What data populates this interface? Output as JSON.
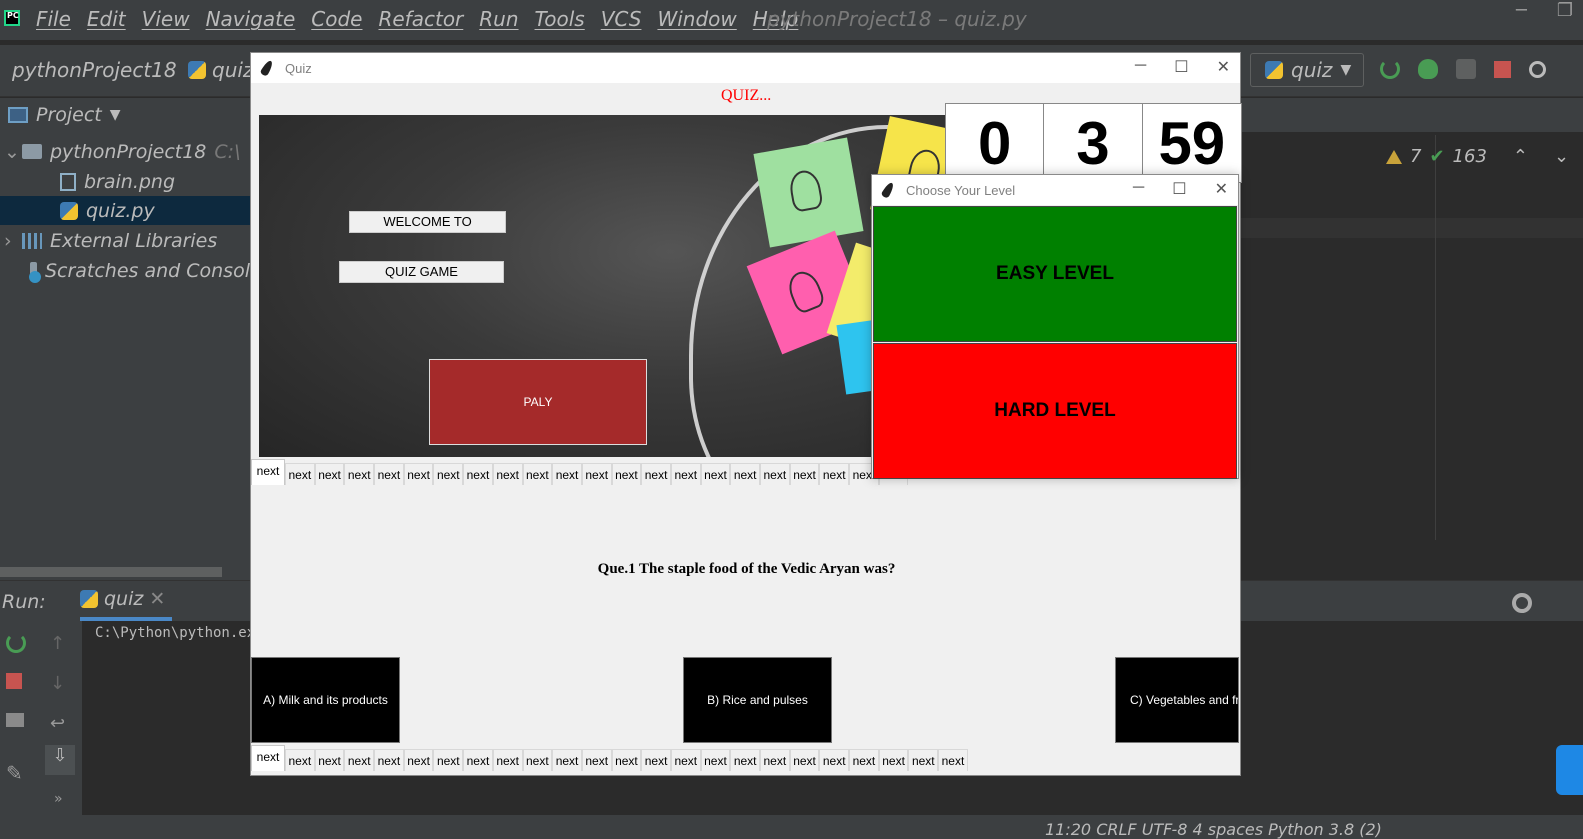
{
  "ide": {
    "menu": [
      "File",
      "Edit",
      "View",
      "Navigate",
      "Code",
      "Refactor",
      "Run",
      "Tools",
      "VCS",
      "Window",
      "Help"
    ],
    "window_title": "pythonProject18 – quiz.py",
    "breadcrumb_project": "pythonProject18",
    "breadcrumb_file": "quiz",
    "run_config": "quiz",
    "project_pane_title": "Project",
    "tree": {
      "root": "pythonProject18",
      "root_path": "C:\\",
      "files": [
        "brain.png",
        "quiz.py"
      ],
      "external": "External Libraries",
      "scratches": "Scratches and Consol"
    },
    "inspections": {
      "warnings": "7",
      "ok": "163"
    },
    "run_label": "Run:",
    "run_tab": "quiz",
    "console_line": "C:\\Python\\python.exe",
    "status": "11:20   CRLF   UTF-8   4 spaces   Python 3.8 (2)"
  },
  "quiz_window": {
    "title": "Quiz",
    "heading": "QUIZ...",
    "welcome": "WELCOME TO",
    "quiz_game": "QUIZ GAME",
    "play": "PALY",
    "timer": {
      "h": "0",
      "m": "3",
      "s": "59"
    },
    "tab_label": "next",
    "question": "Que.1 The staple food of the Vedic Aryan was?",
    "options": {
      "a": "A) Milk and its products",
      "b": "B) Rice and pulses",
      "c": "C) Vegetables and fru"
    }
  },
  "level_window": {
    "title": "Choose Your Level",
    "easy": "EASY LEVEL",
    "hard": "HARD LEVEL"
  },
  "colors": {
    "easy": "#008000",
    "hard": "#ff0000",
    "play": "#a52a2a",
    "heading": "#ff0000"
  }
}
